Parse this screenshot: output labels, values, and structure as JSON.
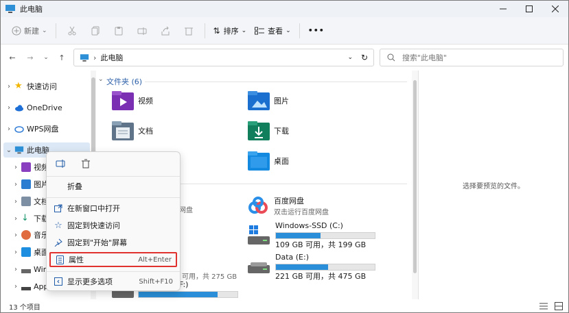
{
  "window": {
    "title": "此电脑"
  },
  "toolbar": {
    "new_label": "新建",
    "sort_label": "排序",
    "view_label": "查看",
    "more_label": "•••"
  },
  "address": {
    "path": "此电脑",
    "search_placeholder": "搜索\"此电脑\""
  },
  "sidebar": {
    "items": [
      {
        "label": "快速访问",
        "icon": "star-icon"
      },
      {
        "label": "OneDrive",
        "icon": "cloud-icon"
      },
      {
        "label": "WPS网盘",
        "icon": "cloud-drive-icon"
      },
      {
        "label": "此电脑",
        "icon": "computer-icon"
      },
      {
        "label": "视频",
        "icon": "video-icon"
      },
      {
        "label": "图片",
        "icon": "picture-icon"
      },
      {
        "label": "文档",
        "icon": "document-icon"
      },
      {
        "label": "下载",
        "icon": "download-icon"
      },
      {
        "label": "音乐",
        "icon": "music-icon"
      },
      {
        "label": "桌面",
        "icon": "desktop-icon"
      },
      {
        "label": "Win",
        "icon": "windows-drive-icon"
      },
      {
        "label": "App",
        "icon": "drive-icon"
      }
    ]
  },
  "content": {
    "folders_header": "文件夹 (6)",
    "folders": [
      {
        "label": "视频"
      },
      {
        "label": "图片"
      },
      {
        "label": "文档"
      },
      {
        "label": "下载"
      },
      {
        "label": "桌面"
      }
    ],
    "devices": [
      {
        "name": "百度网盘",
        "sub": "双击运行百度网盘"
      },
      {
        "name": "Windows-SSD (C:)",
        "sub": "109 GB 可用，共 199 GB",
        "used_fraction": 0.45
      },
      {
        "name": "Data (E:)",
        "sub": "221 GB 可用，共 475 GB",
        "used_fraction": 0.53
      }
    ],
    "partial_texts": {
      "pan": "网盘",
      "d_drive_sub": "可用，共 275 GB",
      "f_drive_name": "F:)"
    },
    "partial_drive_used_fraction": 0.8
  },
  "preview": {
    "text": "选择要预览的文件。"
  },
  "status": {
    "count": "13 个项目"
  },
  "context_menu": {
    "items": [
      {
        "label": "折叠"
      },
      {
        "label": "在新窗口中打开"
      },
      {
        "label": "固定到快速访问"
      },
      {
        "label": "固定到\"开始\"屏幕"
      },
      {
        "label": "属性",
        "shortcut": "Alt+Enter"
      },
      {
        "label": "显示更多选项",
        "shortcut": "Shift+F10"
      }
    ]
  }
}
